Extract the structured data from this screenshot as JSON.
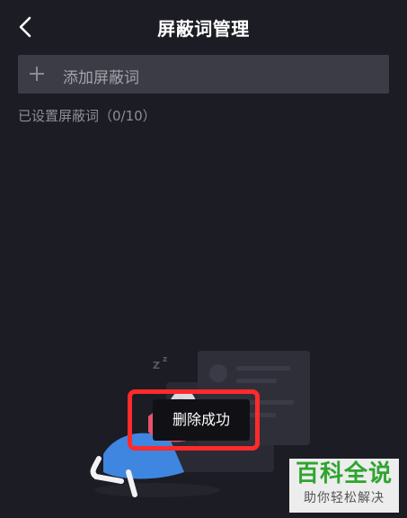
{
  "header": {
    "title": "屏蔽词管理",
    "back_icon": "chevron-left-icon"
  },
  "add_bar": {
    "icon": "plus-icon",
    "label": "添加屏蔽词"
  },
  "status": {
    "count_text": "已设置屏蔽词（0/10）"
  },
  "toast": {
    "message": "删除成功"
  },
  "watermark": {
    "title": "百科全说",
    "subtitle": "助你轻松解决"
  },
  "colors": {
    "background": "#1c1c25",
    "input_bg": "#3c3c46",
    "highlight": "#ff2a2a",
    "watermark_green": "#2fa52f"
  }
}
